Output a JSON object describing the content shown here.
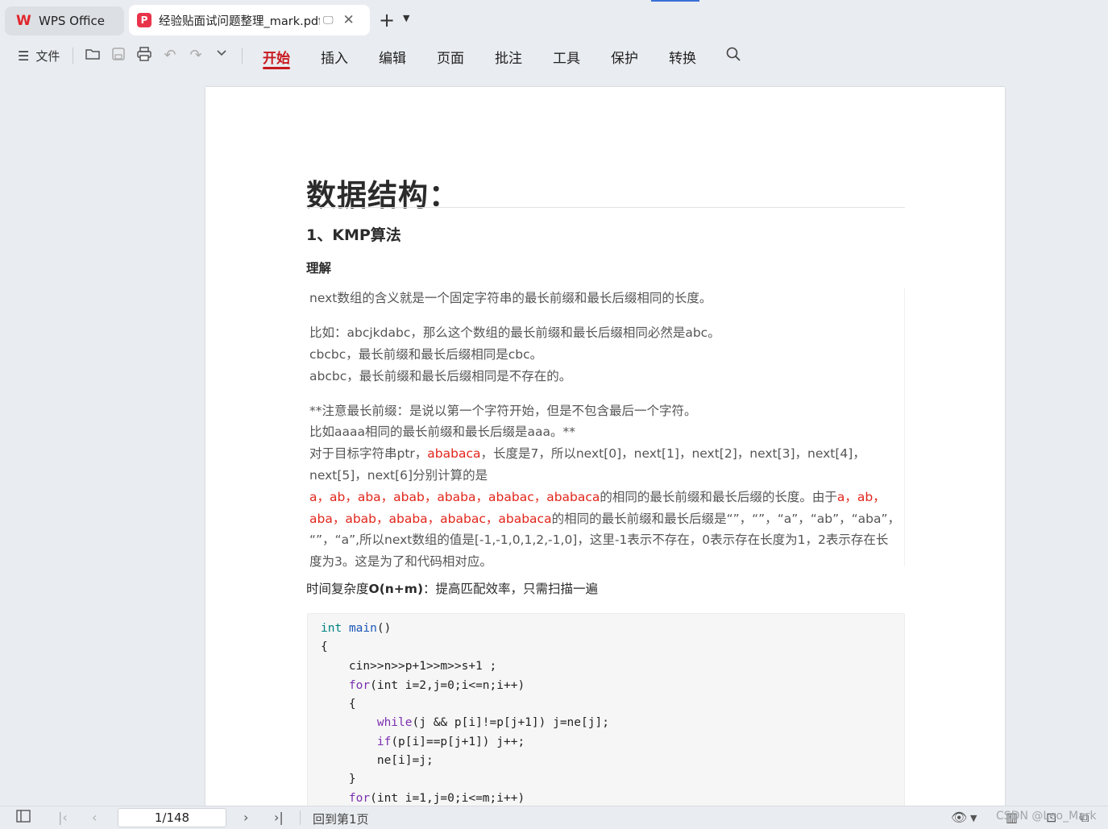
{
  "tabs": {
    "home_label": "WPS Office",
    "doc_label": "经验贴面试问题整理_mark.pdf",
    "new_tab_symbol": "+",
    "dropdown_symbol": "⌄",
    "close_symbol": "✕"
  },
  "toolbar": {
    "menu_label": "文件",
    "tabs": [
      "开始",
      "插入",
      "编辑",
      "页面",
      "批注",
      "工具",
      "保护",
      "转换"
    ],
    "active_tab": "开始",
    "icons": [
      "open-folder-icon",
      "save-icon",
      "print-icon",
      "undo-icon",
      "redo-icon",
      "more-dropdown-icon",
      "search-icon"
    ]
  },
  "document": {
    "h1": "数据结构：",
    "h2": "1、KMP算法",
    "h3": "理解",
    "quote": {
      "l1": "next数组的含义就是一个固定字符串的最长前缀和最长后缀相同的长度。",
      "l2": "比如：abcjkdabc，那么这个数组的最长前缀和最长后缀相同必然是abc。",
      "l3": "cbcbc，最长前缀和最长后缀相同是cbc。",
      "l4": "abcbc，最长前缀和最长后缀相同是不存在的。",
      "l5": "**注意最长前缀：是说以第一个字符开始，但是不包含最后一个字符。",
      "l6": "比如aaaa相同的最长前缀和最长后缀是aaa。**",
      "l7a": "对于目标字符串ptr，",
      "l7red": "ababaca",
      "l7b": "，长度是7，所以next[0]，next[1]，next[2]，next[3]，next[4]，",
      "l8": "next[5]，next[6]分别计算的是",
      "l9red": "a，ab，aba，abab，ababa，ababac，ababaca",
      "l9b": "的相同的最长前缀和最长后缀的长度。由于",
      "l9red2": "a，ab，",
      "l10red": "aba，abab，ababa，ababac，ababaca",
      "l10b": "的相同的最长前缀和最长后缀是“”，“”，“a”，“ab”，“aba”，",
      "l11": "“”，“a”,所以next数组的值是[-1,-1,0,1,2,-1,0]，这里-1表示不存在，0表示存在长度为1，2表示存在长",
      "l12": "度为3。这是为了和代码相对应。"
    },
    "time_prefix": "时间复杂度",
    "time_bold": "O(n+m)",
    "time_suffix": "：提高匹配效率，只需扫描一遍",
    "code": {
      "c1_kw": "int",
      "c1_fn": "main",
      "c1_rest": "()",
      "c2": "{",
      "c3": "    cin>>n>>p+1>>m>>s+1 ;",
      "c4_kw": "for",
      "c4_rest": "(int i=2,j=0;i<=n;i++)",
      "c5": "    {",
      "c6_kw": "while",
      "c6_rest": "(j && p[i]!=p[j+1]) j=ne[j];",
      "c7_kw": "if",
      "c7_rest": "(p[i]==p[j+1]) j++;",
      "c8": "        ne[i]=j;",
      "c9": "    }",
      "c10_kw": "for",
      "c10_rest": "(int i=1,j=0;i<=m;i++)"
    }
  },
  "statusbar": {
    "page_indicator": "1/148",
    "back_to_first": "回到第1页",
    "watermark": "CSDN @Leo_Mark"
  }
}
